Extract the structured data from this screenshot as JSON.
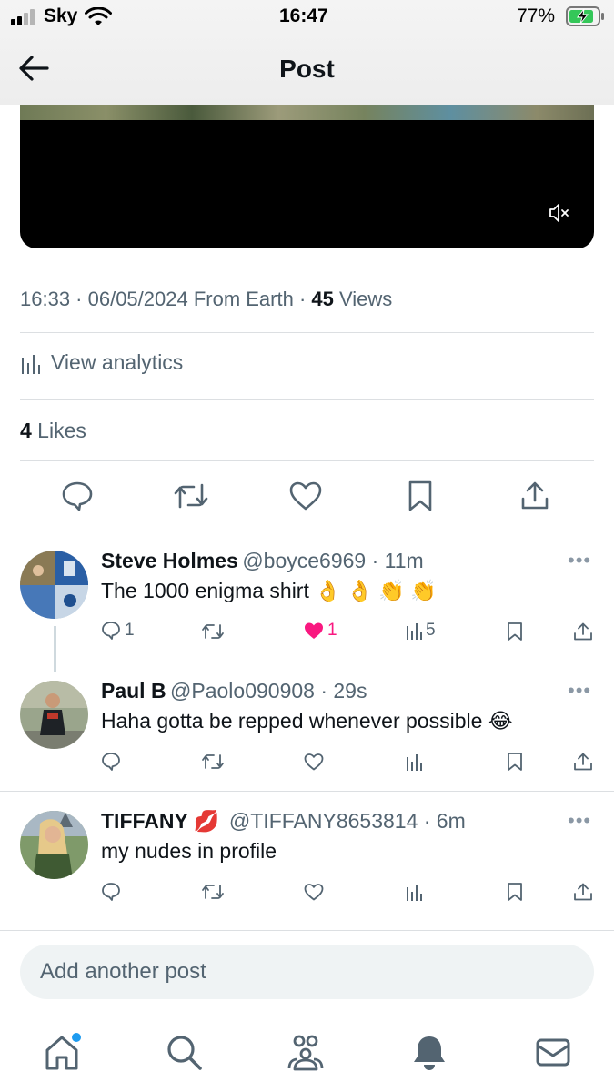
{
  "status_bar": {
    "carrier": "Sky",
    "time": "16:47",
    "battery": "77%"
  },
  "header": {
    "title": "Post",
    "back_icon": "arrow-left-icon"
  },
  "video": {
    "mute_icon": "speaker-muted-icon"
  },
  "post_meta": {
    "timestamp": "16:33 · 06/05/2024 From Earth · ",
    "views_count": "45",
    "views_label": " Views"
  },
  "analytics": {
    "label": "View analytics"
  },
  "likes": {
    "count": "4",
    "label": " Likes"
  },
  "actions": [
    "reply-icon",
    "repost-icon",
    "like-icon",
    "bookmark-icon",
    "share-icon"
  ],
  "replies": [
    {
      "name": "Steve Holmes",
      "handle": "@boyce6969 · 11m",
      "text": "The 1000 enigma shirt 👌 👌 👏 👏",
      "reply_count": "1",
      "like_count": "1",
      "views": "5",
      "liked": true
    },
    {
      "name": "Paul B",
      "handle": "@Paolo090908 · 29s",
      "text": "Haha gotta be repped whenever possible 😂",
      "reply_count": "",
      "like_count": "",
      "views": "",
      "liked": false
    },
    {
      "name": "TIFFANY 💋",
      "handle": "@TIFFANY8653814 · 6m",
      "text": "my nudes in profile",
      "reply_count": "",
      "like_count": "",
      "views": "",
      "liked": false
    }
  ],
  "composer": {
    "placeholder": "Add another post"
  },
  "tab_bar": [
    "home-icon",
    "search-icon",
    "communities-icon",
    "notifications-icon",
    "messages-icon"
  ],
  "colors": {
    "accent": "#1d9bf0",
    "like": "#f91880",
    "battery": "#34c759"
  }
}
